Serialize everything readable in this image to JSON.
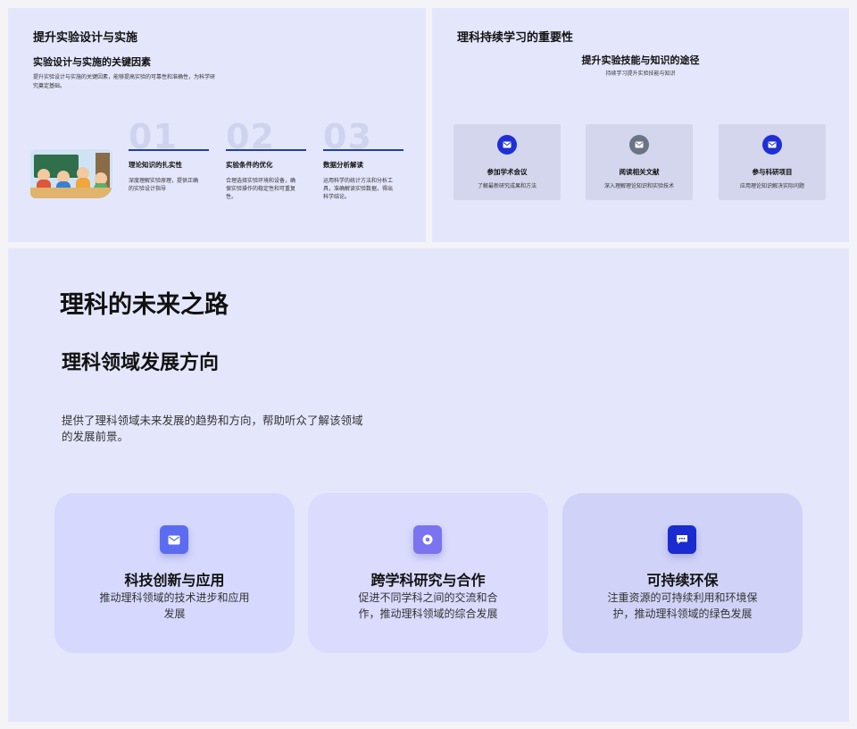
{
  "slide1": {
    "title": "提升实验设计与实施",
    "subtitle": "实验设计与实施的关键因素",
    "description": "提升实验设计与实施的关键因素，能够提高实验的可靠性和准确性，为科学研究奠定基础。",
    "columns": [
      {
        "num": "01",
        "title": "理论知识的扎实性",
        "desc": "深度理解实验原理，提供正确的实验设计指导"
      },
      {
        "num": "02",
        "title": "实验条件的优化",
        "desc": "合理选择实验环境和设备，确保实验操作的稳定性和可重复性。"
      },
      {
        "num": "03",
        "title": "数据分析解读",
        "desc": "运用科学的统计方法和分析工具，准确解读实验数据，得出科学结论。"
      }
    ]
  },
  "slide2": {
    "title": "理科持续学习的重要性",
    "subtitle": "提升实验技能与知识的途径",
    "subdesc": "持续学习提升实验技能与知识",
    "cards": [
      {
        "icon": "mail-icon",
        "color": "#1f2fd6",
        "title": "参加学术会议",
        "desc": "了解最新研究成果和方法"
      },
      {
        "icon": "mail-icon",
        "color": "#6b7484",
        "title": "阅读相关文献",
        "desc": "深入理解理论知识和实验技术"
      },
      {
        "icon": "mail-icon",
        "color": "#1f2fd6",
        "title": "参与科研项目",
        "desc": "应用理论知识解决实际问题"
      }
    ]
  },
  "slide3": {
    "title": "理科的未来之路",
    "subtitle": "理科领域发展方向",
    "description": "提供了理科领域未来发展的趋势和方向，帮助听众了解该领域的发展前景。",
    "cards": [
      {
        "icon": "mail-icon",
        "color": "#5b6cf0",
        "bg": "#d6d9fd",
        "title": "科技创新与应用",
        "desc": "推动理科领域的技术进步和应用发展"
      },
      {
        "icon": "target-icon",
        "color": "#7b73f0",
        "bg": "#dadbfd",
        "title": "跨学科研究与合作",
        "desc": "促进不同学科之间的交流和合作，推动理科领域的综合发展"
      },
      {
        "icon": "chat-icon",
        "color": "#1a2bd0",
        "bg": "#d0d3f7",
        "title": "可持续环保",
        "desc": "注重资源的可持续利用和环境保护，推动理科领域的绿色发展"
      }
    ]
  }
}
